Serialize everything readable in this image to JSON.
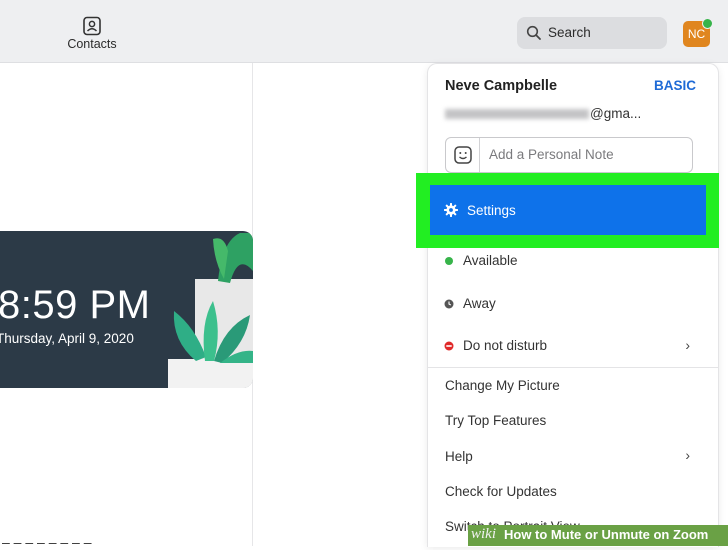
{
  "header": {
    "contacts_label": "Contacts",
    "search_label": "Search",
    "avatar_initials": "NC"
  },
  "clock": {
    "time": "8:59 PM",
    "date": "Thursday, April 9, 2020"
  },
  "profile": {
    "name": "Neve Campbelle",
    "plan": "BASIC",
    "email_suffix": "@gma..."
  },
  "note": {
    "placeholder": "Add a Personal Note"
  },
  "menu": {
    "settings": "Settings",
    "status": [
      {
        "label": "Available",
        "color": "#37b44a"
      },
      {
        "label": "Away",
        "color": "#555555"
      },
      {
        "label": "Do not disturb",
        "color": "#e02a2a"
      }
    ],
    "items": [
      "Change My Picture",
      "Try Top Features",
      "Help",
      "Check for Updates",
      "Switch to Portrait View"
    ]
  },
  "watermark": {
    "brand": "wiki",
    "title": "How to Mute or Unmute on Zoom"
  },
  "colors": {
    "accent": "#0e72ea",
    "highlight": "#22ee22",
    "avatar": "#e0861f"
  }
}
